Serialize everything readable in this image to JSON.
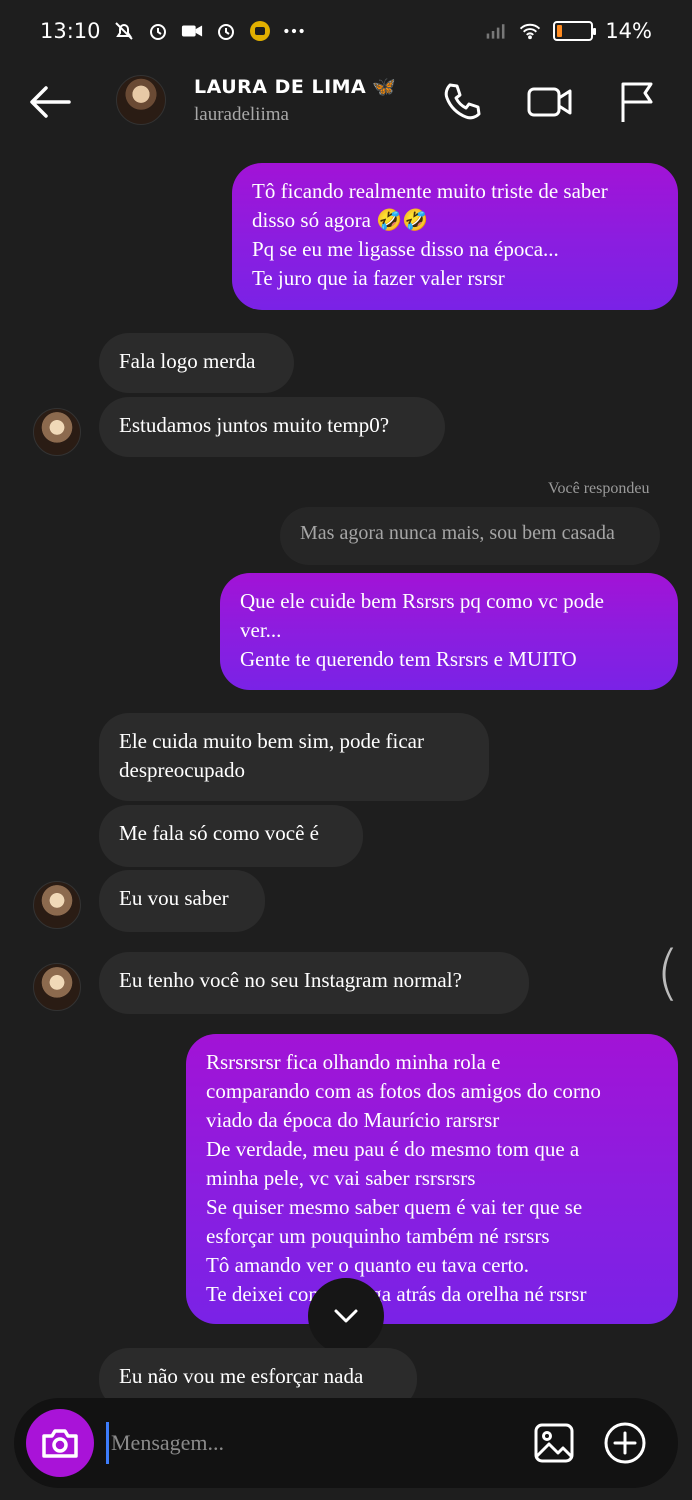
{
  "status_bar": {
    "time": "13:10",
    "left_icons": [
      "bell-off-icon",
      "alarm-icon",
      "video-record-icon",
      "alarm-icon",
      "app-notification-icon",
      "more-dots-icon"
    ],
    "battery_percent": "14%",
    "battery_level": 0.14,
    "battery_color": "#ff8a1f"
  },
  "header": {
    "name": "LAURA DE LIMA",
    "emoji": "🦋",
    "username": "lauradeliima"
  },
  "messages": {
    "m1": "Tô ficando realmente muito triste de saber\ndisso só agora 🤣🤣\nPq se eu me ligasse disso na época...\nTe juro que ia fazer valer rsrsr",
    "m2": "Fala logo merda",
    "m3": "Estudamos juntos muito temp0?",
    "reply_label": "Você respondeu",
    "reply_quote": "Mas agora nunca mais, sou bem casada",
    "m4": "Que ele cuide bem Rsrsrs pq como vc pode\nver...\nGente te querendo tem Rsrsrs e MUITO",
    "m5": "Ele cuida muito bem sim, pode ficar\ndespreocupado",
    "m6": "Me fala só como você é",
    "m7": "Eu vou saber",
    "m8": "Eu tenho você no seu Instagram normal?",
    "m9": "Rsrsrsrsr fica olhando minha rola e\ncomparando com as fotos dos amigos do corno\nviado da época do Maurício rarsrsr\nDe verdade, meu pau é do mesmo tom que a\nminha pele, vc vai saber rsrsrsrs\nSe quiser mesmo saber quem é vai ter que se\nesforçar um pouquinho também né rsrsrs\nTô amando ver o quanto eu tava certo.\nTe deixei com a pulga atrás da orelha né rsrsr",
    "m10": "Eu não vou me esforçar nada"
  },
  "composer": {
    "placeholder": "Mensagem..."
  },
  "colors": {
    "background": "#1e1e1e",
    "incoming_bubble": "#2b2b2b",
    "outgoing_gradient_start": "#a213d6",
    "outgoing_gradient_end": "#7a22e6",
    "camera_button": "#a913d8"
  }
}
